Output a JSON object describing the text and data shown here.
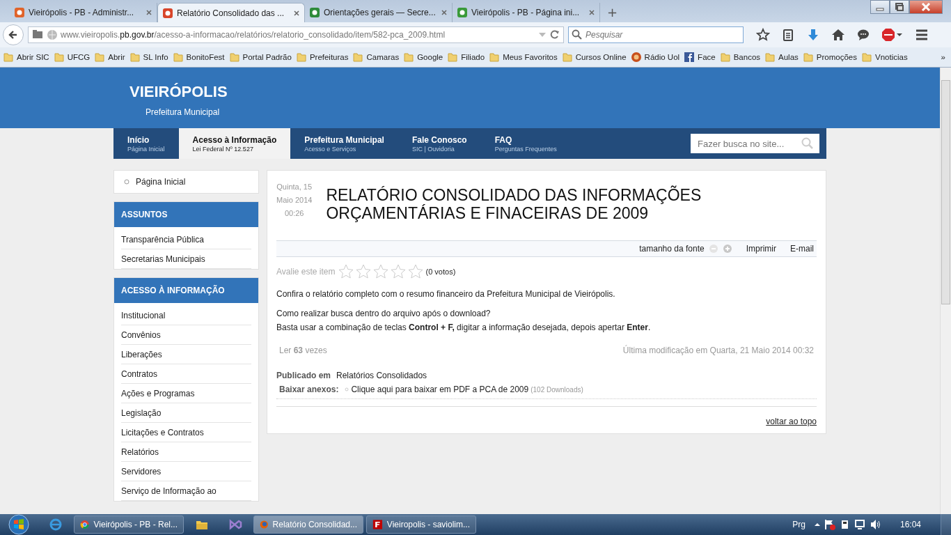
{
  "browser": {
    "tabs": [
      {
        "title": "Vieirópolis - PB - Administr...",
        "selected": false,
        "color": "#e0632a"
      },
      {
        "title": "Relatório Consolidado das ...",
        "selected": true,
        "color": "#d8452a"
      },
      {
        "title": "Orientações gerais — Secre...",
        "selected": false,
        "color": "#2e8b3a"
      },
      {
        "title": "Vieirópolis - PB - Página ini...",
        "selected": false,
        "color": "#3a9a3a"
      }
    ],
    "new_tab": "+",
    "url": {
      "start": "www.vieiropolis.",
      "host": "pb.gov.br",
      "path": "/acesso-a-informacao/relatórios/relatorio_consolidado/item/582-pca_2009.html"
    },
    "search": {
      "placeholder": "Pesquisar"
    },
    "bookmarks": [
      {
        "label": "Abrir SIC",
        "kind": "folder"
      },
      {
        "label": "UFCG",
        "kind": "folder"
      },
      {
        "label": "Abrir",
        "kind": "folder"
      },
      {
        "label": "SL Info",
        "kind": "folder"
      },
      {
        "label": "BonitoFest",
        "kind": "folder"
      },
      {
        "label": "Portal Padrão",
        "kind": "folder"
      },
      {
        "label": "Prefeituras",
        "kind": "folder"
      },
      {
        "label": "Camaras",
        "kind": "folder"
      },
      {
        "label": "Google",
        "kind": "folder"
      },
      {
        "label": "Filiado",
        "kind": "folder"
      },
      {
        "label": "Meus Favoritos",
        "kind": "folder"
      },
      {
        "label": "Cursos Online",
        "kind": "folder"
      },
      {
        "label": "Rádio Uol",
        "kind": "radio"
      },
      {
        "label": "Face",
        "kind": "facebook"
      },
      {
        "label": "Bancos",
        "kind": "folder"
      },
      {
        "label": "Aulas",
        "kind": "folder"
      },
      {
        "label": "Promoções",
        "kind": "folder"
      },
      {
        "label": "Vnoticias",
        "kind": "folder"
      }
    ],
    "bookmarks_more": "»"
  },
  "site": {
    "title": "VIEIRÓPOLIS",
    "subtitle": "Prefeitura Municipal",
    "nav": [
      {
        "label": "Início",
        "sub": "Página Inicial",
        "selected": false
      },
      {
        "label": "Acesso à Informação",
        "sub": "Lei Federal Nº 12.527",
        "selected": true
      },
      {
        "label": "Prefeitura Municipal",
        "sub": "Acesso e Serviços",
        "selected": false
      },
      {
        "label": "Fale Conosco",
        "sub": "SIC | Ouvidoria",
        "selected": false
      },
      {
        "label": "FAQ",
        "sub": "Perguntas Frequentes",
        "selected": false
      }
    ],
    "search": {
      "placeholder": "Fazer busca no site..."
    }
  },
  "sidebar": {
    "home": "Página Inicial",
    "sections": [
      {
        "title": "ASSUNTOS",
        "items": [
          "Transparência Pública",
          "Secretarias Municipais"
        ]
      },
      {
        "title": "ACESSO À INFORMAÇÃO",
        "items": [
          "Institucional",
          "Convênios",
          "Liberações",
          "Contratos",
          "Ações e Programas",
          "Legislação",
          "Licitações e Contratos",
          "Relatórios",
          "Servidores",
          "Serviço de Informação ao"
        ]
      }
    ]
  },
  "article": {
    "date": [
      "Quinta, 15",
      "Maio 2014",
      "00:26"
    ],
    "title": "RELATÓRIO CONSOLIDADO DAS INFORMAÇÕES ORÇAMENTÁRIAS E FINACEIRAS DE 2009",
    "font_size_label": "tamanho da fonte",
    "tools": [
      "Imprimir",
      "E-mail"
    ],
    "rating": {
      "label": "Avalie este item",
      "stars": 0,
      "votes": "(0 votos)"
    },
    "paragraphs": [
      "Confira o relatório completo com o resumo financeiro da Prefeitura Municipal de Vieirópolis.",
      "Como realizar busca dentro do arquivo após o download?\nBasta usar a combinação de teclas **Control + F,** digitar a informação desejada, depois apertar **Enter**."
    ],
    "hits": "Ler **63** vezes",
    "modified": "Última modificação em Quarta, 21 Maio 2014 00:32",
    "published_label": "Publicado em",
    "published_value": "Relatórios Consolidados",
    "attachments_label": "Baixar anexos:",
    "attachment_link": "Clique aqui para baixar em PDF a PCA de 2009",
    "attachment_count": "(102 Downloads)",
    "back_to_top": "voltar ao topo"
  },
  "taskbar": {
    "items": [
      {
        "kind": "ie",
        "selected": false
      },
      {
        "kind": "chrome",
        "label": "Vieirópolis - PB - Rel...",
        "selected": false
      },
      {
        "kind": "explorer",
        "selected": false
      },
      {
        "kind": "vs",
        "selected": false
      },
      {
        "kind": "firefox",
        "label": "Relatório Consolidad...",
        "selected": true
      },
      {
        "kind": "filezilla",
        "label": "Vieiropolis - saviolim...",
        "selected": false
      }
    ],
    "language": "Prg",
    "time": "16:04"
  }
}
